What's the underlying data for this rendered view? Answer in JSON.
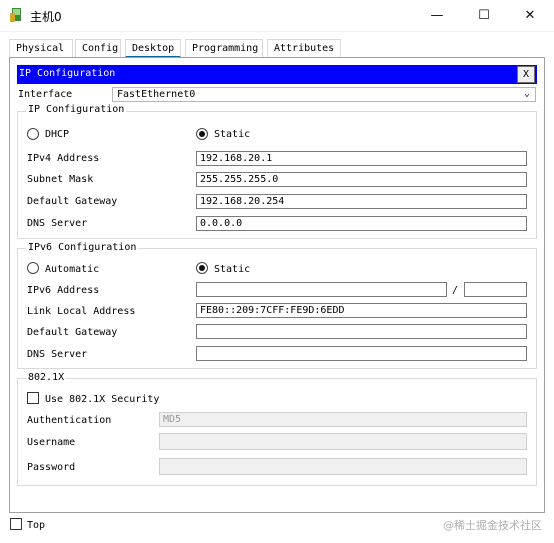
{
  "window": {
    "title": "主机0",
    "minimize": "—",
    "maximize": "☐",
    "close": "✕"
  },
  "tabs": [
    "Physical",
    "Config",
    "Desktop",
    "Programming",
    "Attributes"
  ],
  "active_tab": "Desktop",
  "ip_config": {
    "header": "IP Configuration",
    "close_label": "X",
    "interface_label": "Interface",
    "interface_value": "FastEthernet0",
    "ipv4": {
      "group_title": "IP Configuration",
      "dhcp_label": "DHCP",
      "static_label": "Static",
      "mode": "Static",
      "ipv4_address_label": "IPv4 Address",
      "ipv4_address": "192.168.20.1",
      "subnet_mask_label": "Subnet Mask",
      "subnet_mask": "255.255.255.0",
      "default_gateway_label": "Default Gateway",
      "default_gateway": "192.168.20.254",
      "dns_server_label": "DNS Server",
      "dns_server": "0.0.0.0"
    },
    "ipv6": {
      "group_title": "IPv6 Configuration",
      "automatic_label": "Automatic",
      "static_label": "Static",
      "mode": "Static",
      "ipv6_address_label": "IPv6 Address",
      "ipv6_address": "",
      "prefix_separator": "/",
      "prefix_length": "",
      "link_local_label": "Link Local Address",
      "link_local": "FE80::209:7CFF:FE9D:6EDD",
      "default_gateway_label": "Default Gateway",
      "default_gateway": "",
      "dns_server_label": "DNS Server",
      "dns_server": ""
    },
    "dot1x": {
      "group_title": "802.1X",
      "use_label": "Use 802.1X Security",
      "use_checked": false,
      "auth_label": "Authentication",
      "auth_value": "MD5",
      "username_label": "Username",
      "username": "",
      "password_label": "Password",
      "password": ""
    }
  },
  "footer": {
    "top_label": "Top",
    "top_checked": false
  },
  "watermark": "@稀土掘金技术社区"
}
